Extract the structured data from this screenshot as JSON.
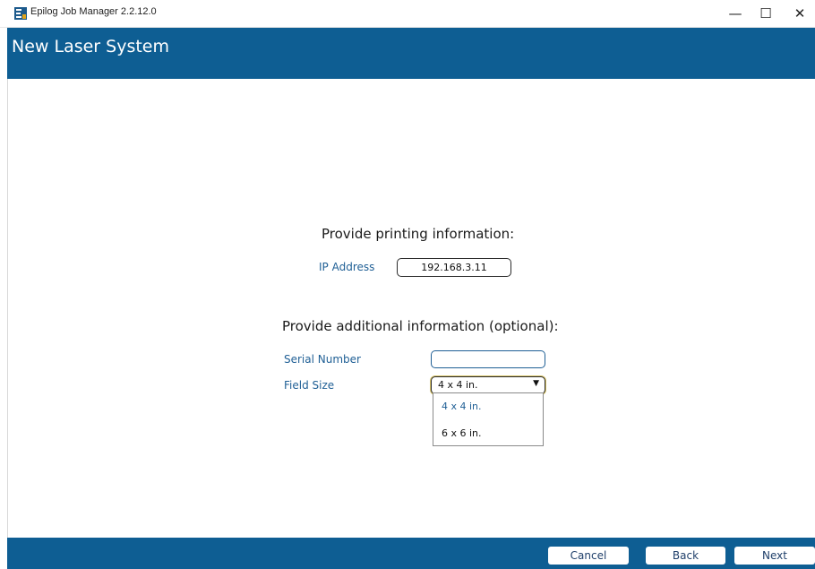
{
  "window": {
    "title": "Epilog Job Manager 2.2.12.0",
    "minimize_glyph": "—",
    "maximize_glyph": "☐",
    "close_glyph": "✕"
  },
  "header": {
    "title": "New Laser System"
  },
  "printing": {
    "heading": "Provide printing information:",
    "ip_label": "IP Address",
    "ip_value": "192.168.3.11"
  },
  "additional": {
    "heading": "Provide additional information (optional):",
    "serial_label": "Serial Number",
    "serial_value": "",
    "field_size_label": "Field Size",
    "field_size_value": "4 x 4 in.",
    "field_size_caret": "▼",
    "field_size_options": [
      "4 x 4 in.",
      "6 x 6 in."
    ]
  },
  "footer": {
    "cancel_label": "Cancel",
    "back_label": "Back",
    "next_label": "Next"
  },
  "colors": {
    "brand_blue": "#0e5e93",
    "label_blue": "#1f5f95"
  },
  "icons": {
    "app": "epilog-app-icon",
    "dropdown": "chevron-down-icon"
  }
}
